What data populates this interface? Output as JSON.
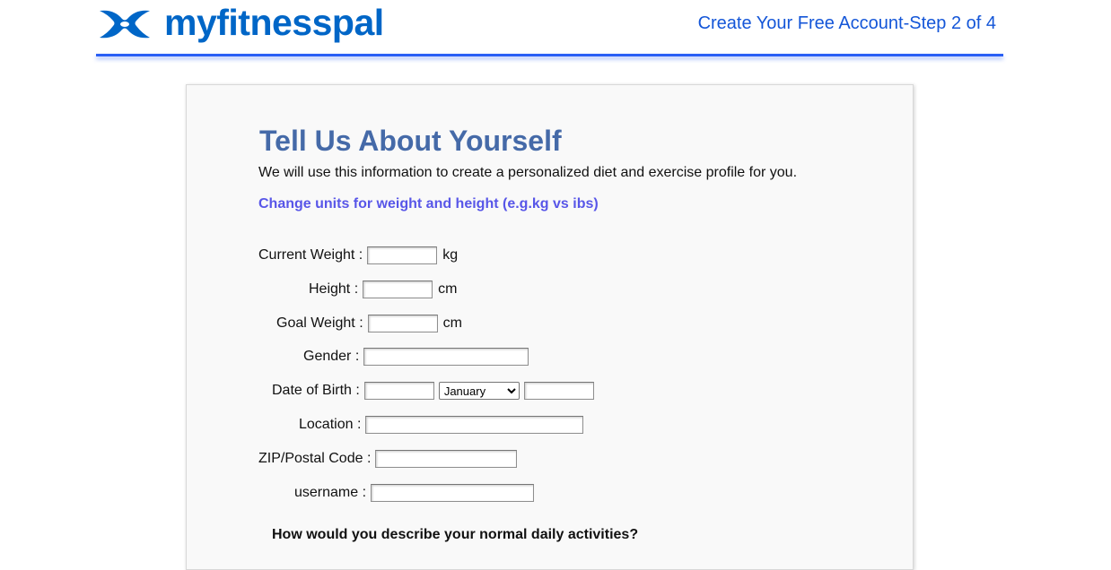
{
  "header": {
    "logo_text": "myfitnesspal",
    "step_text": "Create Your Free Account-Step 2 of 4",
    "brand_color": "#0066c7",
    "accent_color": "#2a5ff5"
  },
  "form": {
    "title": "Tell Us About Yourself",
    "intro": "We will use this information to create a personalized diet and exercise profile for you.",
    "units_link": "Change units for weight and height (e.g.kg vs ibs)",
    "fields": {
      "current_weight": {
        "label": "Current Weight :",
        "unit": "kg",
        "value": ""
      },
      "height": {
        "label": "Height :",
        "unit": "cm",
        "value": ""
      },
      "goal_weight": {
        "label": "Goal Weight :",
        "unit": "cm",
        "value": ""
      },
      "gender": {
        "label": "Gender :",
        "value": ""
      },
      "dob": {
        "label": "Date of Birth :",
        "day_value": "",
        "month_value": "January",
        "year_value": ""
      },
      "location": {
        "label": "Location :",
        "value": ""
      },
      "zip": {
        "label": "ZIP/Postal Code :",
        "value": ""
      },
      "username": {
        "label": "username :",
        "value": ""
      }
    },
    "activity_question": "How would you describe your normal daily activities?"
  }
}
